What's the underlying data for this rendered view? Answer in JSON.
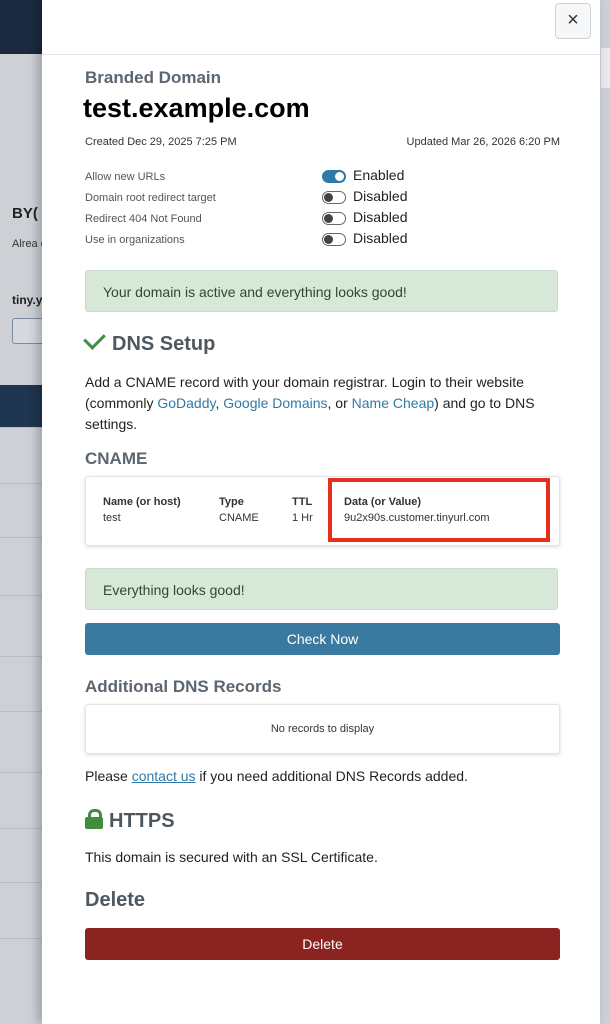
{
  "background": {
    "heading": "BY(",
    "text": "Alrea creat shor",
    "tiny_label": "tiny.y"
  },
  "panel": {
    "close_label": "×",
    "branded_domain_label": "Branded Domain",
    "domain": "test.example.com",
    "created": "Created Dec 29, 2025 7:25 PM",
    "updated": "Updated Mar 26, 2026 6:20 PM",
    "settings": [
      {
        "label": "Allow new URLs",
        "status": "Enabled",
        "enabled": true
      },
      {
        "label": "Domain root redirect target",
        "status": "Disabled",
        "enabled": false
      },
      {
        "label": "Redirect 404 Not Found",
        "status": "Disabled",
        "enabled": false
      },
      {
        "label": "Use in organizations",
        "status": "Disabled",
        "enabled": false
      }
    ],
    "status_alert": "Your domain is active and everything looks good!",
    "dns": {
      "title": "DNS Setup",
      "intro_1": "Add a CNAME record with your domain registrar. Login to their website (commonly ",
      "godaddy": "GoDaddy",
      "sep_1": ", ",
      "google": "Google Domains",
      "sep_2": ", or ",
      "namecheap": "Name Cheap",
      "intro_2": ") and go to DNS settings.",
      "cname_title": "CNAME",
      "cname": {
        "name_header": "Name (or host)",
        "name_value": "test",
        "type_header": "Type",
        "type_value": "CNAME",
        "ttl_header": "TTL",
        "ttl_value": "1 Hr",
        "data_header": "Data (or Value)",
        "data_value": "9u2x90s.customer.tinyurl.com"
      },
      "check_alert": "Everything looks good!",
      "check_button": "Check Now"
    },
    "additional": {
      "title": "Additional DNS Records",
      "empty": "No records to display",
      "note_1": "Please ",
      "contact_link": "contact us",
      "note_2": " if you need additional DNS Records added."
    },
    "https": {
      "title": "HTTPS",
      "text": "This domain is secured with an SSL Certificate."
    },
    "delete": {
      "title": "Delete",
      "button": "Delete"
    }
  }
}
